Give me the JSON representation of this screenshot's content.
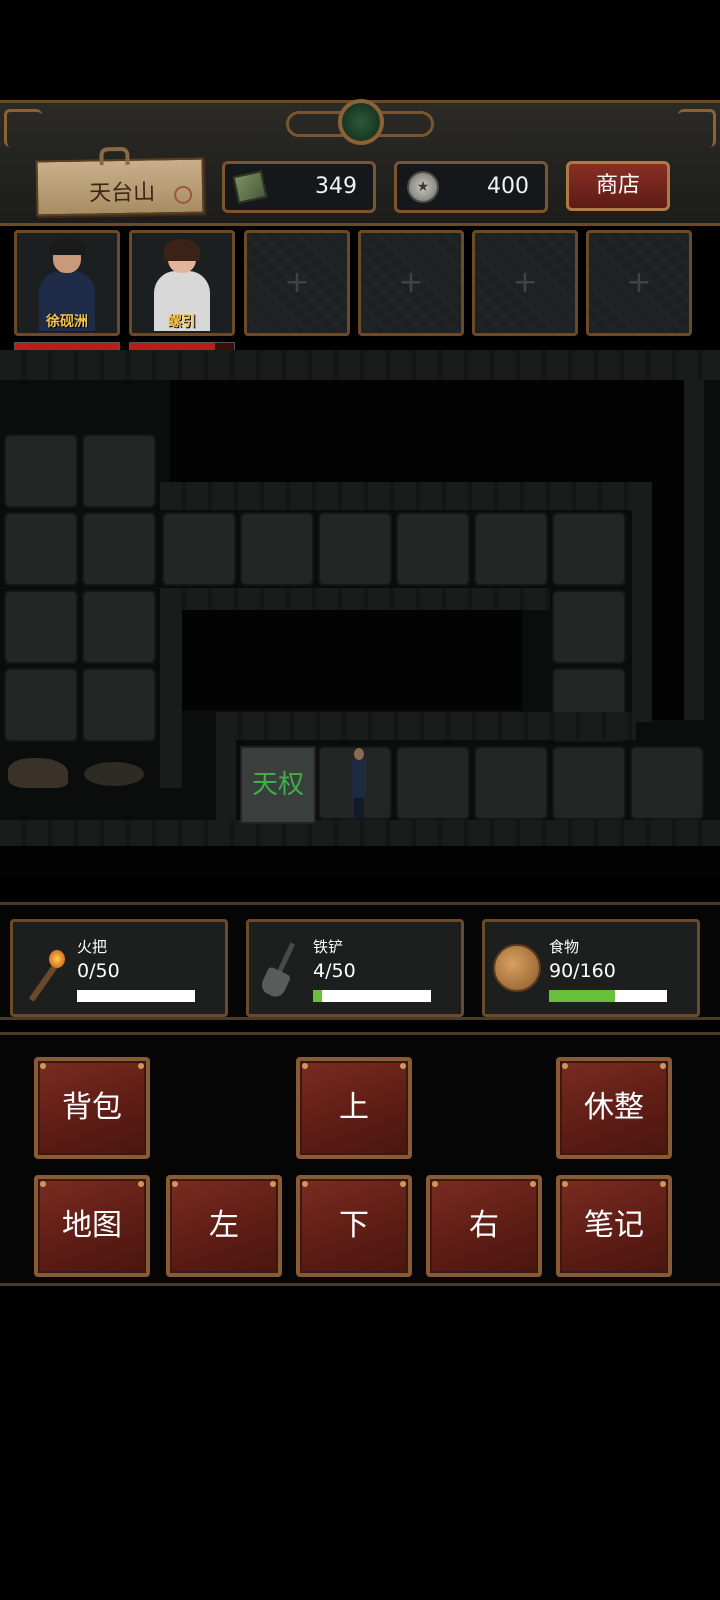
{
  "header": {
    "location": "天台山",
    "money": "349",
    "coins": "400",
    "shop_label": "商店"
  },
  "party": {
    "members": [
      {
        "name": "徐砚洲",
        "hp": 1.0
      },
      {
        "name": "螺引",
        "hp": 0.82
      }
    ],
    "empty_slot_symbol": "+"
  },
  "map": {
    "stone_sign_text": "天权"
  },
  "status": {
    "torch": {
      "label": "火把",
      "value": "0/50",
      "fraction": 0.0
    },
    "shovel": {
      "label": "铁铲",
      "value": "4/50",
      "fraction": 0.08
    },
    "food": {
      "label": "食物",
      "value": "90/160",
      "fraction": 0.5625
    }
  },
  "controls": {
    "bag": "背包",
    "up": "上",
    "rest": "休整",
    "map": "地图",
    "left": "左",
    "down": "下",
    "right": "右",
    "notes": "笔记"
  },
  "colors": {
    "frame": "#6b4a2a",
    "button_red": "#6b2418",
    "hp_red": "#b81e1e",
    "bar_green": "#6abf3a",
    "name_gold": "#f2c24a"
  }
}
